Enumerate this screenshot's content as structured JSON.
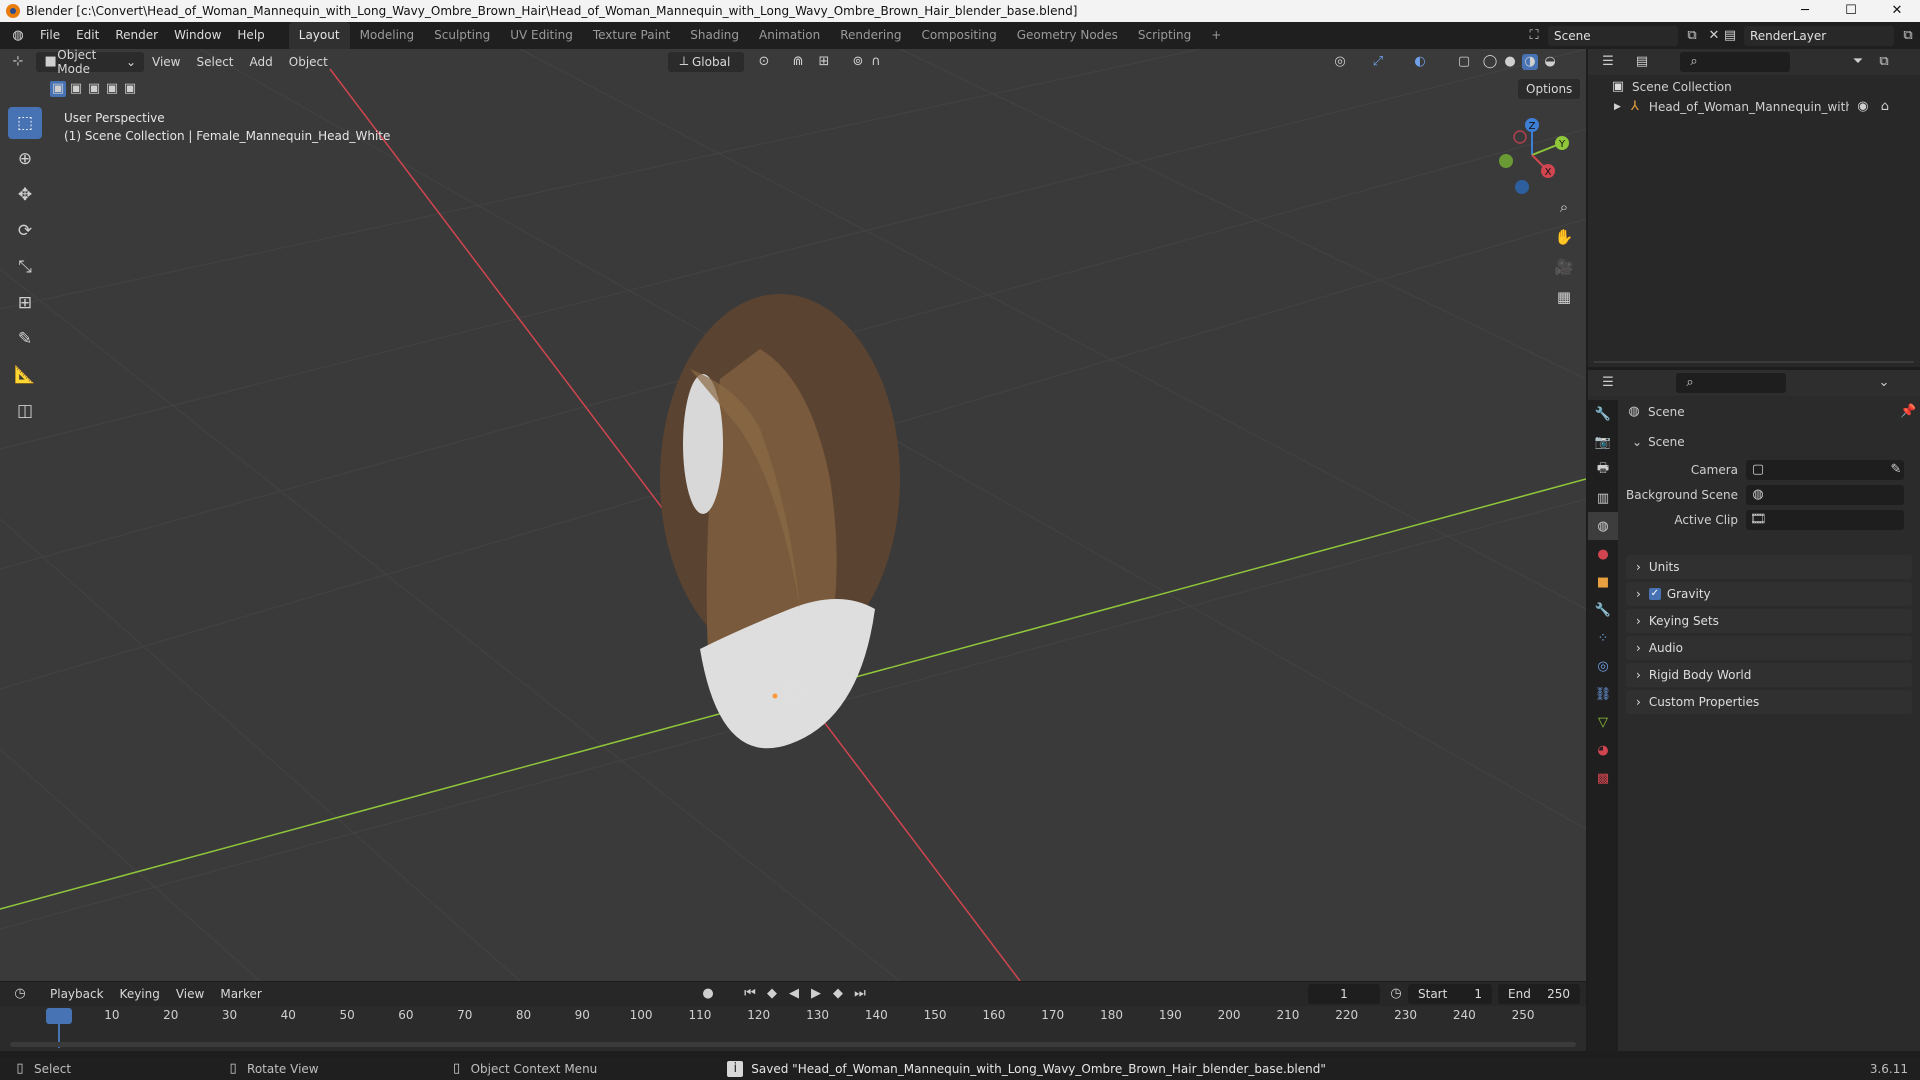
{
  "window": {
    "title": "Blender [c:\\Convert\\Head_of_Woman_Mannequin_with_Long_Wavy_Ombre_Brown_Hair\\Head_of_Woman_Mannequin_with_Long_Wavy_Ombre_Brown_Hair_blender_base.blend]",
    "minimize": "─",
    "maximize": "☐",
    "close": "✕"
  },
  "menu": [
    "File",
    "Edit",
    "Render",
    "Window",
    "Help"
  ],
  "workspaces": [
    "Layout",
    "Modeling",
    "Sculpting",
    "UV Editing",
    "Texture Paint",
    "Shading",
    "Animation",
    "Rendering",
    "Compositing",
    "Geometry Nodes",
    "Scripting",
    "+"
  ],
  "scene_name": "Scene",
  "render_layer": "RenderLayer",
  "viewport": {
    "mode": "Object Mode",
    "menus": [
      "View",
      "Select",
      "Add",
      "Object"
    ],
    "transform_orientation": "Global",
    "options": "Options",
    "perspective": "User Perspective",
    "collection_info": "(1) Scene Collection | Female_Mannequin_Head_White",
    "gizmo": {
      "x": "X",
      "y": "Y",
      "z": "Z"
    }
  },
  "outliner": {
    "root": "Scene Collection",
    "items": [
      "Head_of_Woman_Mannequin_with_Long"
    ]
  },
  "properties": {
    "context": "Scene",
    "section": "Scene",
    "fields": [
      {
        "label": "Camera"
      },
      {
        "label": "Background Scene"
      },
      {
        "label": "Active Clip"
      }
    ],
    "panels": [
      "Units",
      "Gravity",
      "Keying Sets",
      "Audio",
      "Rigid Body World",
      "Custom Properties"
    ]
  },
  "timeline": {
    "menus": [
      "Playback",
      "Keying",
      "View",
      "Marker"
    ],
    "current_frame": "1",
    "start_label": "Start",
    "start": "1",
    "end_label": "End",
    "end": "250",
    "ticks": [
      "1",
      "10",
      "20",
      "30",
      "40",
      "50",
      "60",
      "70",
      "80",
      "90",
      "100",
      "110",
      "120",
      "130",
      "140",
      "150",
      "160",
      "170",
      "180",
      "190",
      "200",
      "210",
      "220",
      "230",
      "240",
      "250"
    ]
  },
  "status": {
    "select": "Select",
    "rotate": "Rotate View",
    "context_menu": "Object Context Menu",
    "message": "Saved \"Head_of_Woman_Mannequin_with_Long_Wavy_Ombre_Brown_Hair_blender_base.blend\"",
    "version": "3.6.11"
  },
  "colors": {
    "accent": "#4772b3",
    "x_axis": "#d0454f",
    "y_axis": "#8fc63a",
    "z_axis": "#3d7fd6"
  }
}
